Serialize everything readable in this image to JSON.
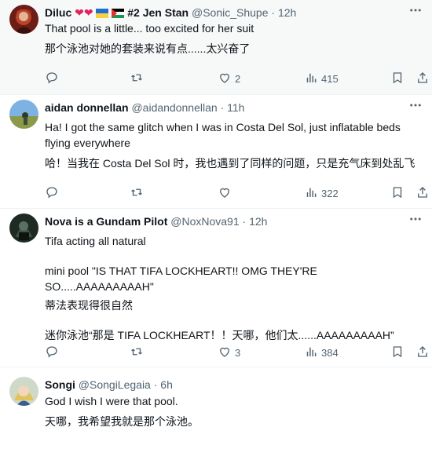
{
  "tweets": [
    {
      "display_name": "Diluc",
      "badge_text": "#2 Jen Stan",
      "handle": "@Sonic_Shupe",
      "separator": "·",
      "time": "12h",
      "lines": [
        "That pool is a little... too excited for her suit",
        "那个泳池对她的套装来说有点......太兴奋了"
      ],
      "replies": "",
      "retweets": "",
      "likes": "2",
      "views": "415"
    },
    {
      "display_name": "aidan donnellan",
      "handle": "@aidandonnellan",
      "separator": "·",
      "time": "11h",
      "lines": [
        "Ha! I got the same glitch when I was in Costa Del Sol, just inflatable beds flying everywhere",
        "哈！当我在 Costa Del Sol 时，我也遇到了同样的问题，只是充气床到处乱飞"
      ],
      "replies": "",
      "retweets": "",
      "likes": "",
      "views": "322"
    },
    {
      "display_name": "Nova is a Gundam Pilot",
      "handle": "@NoxNova91",
      "separator": "·",
      "time": "12h",
      "lines": [
        "Tifa acting all natural",
        "",
        "mini pool \"IS THAT TIFA LOCKHEART!! OMG THEY'RE SO.....AAAAAAAAAH\"",
        "蒂法表现得很自然",
        "",
        "迷你泳池“那是 TIFA LOCKHEART！！天哪，他们太......AAAAAAAAAH”"
      ],
      "replies": "",
      "retweets": "",
      "likes": "3",
      "views": "384"
    },
    {
      "display_name": "Songi",
      "handle": "@SongiLegaia",
      "separator": "·",
      "time": "6h",
      "lines": [
        "God I wish I were that pool.",
        "天哪，我希望我就是那个泳池。"
      ]
    }
  ]
}
